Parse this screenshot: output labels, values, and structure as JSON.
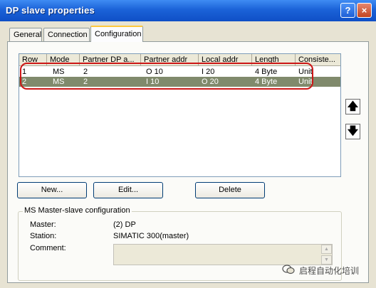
{
  "window": {
    "title": "DP slave properties"
  },
  "tabs": [
    "General",
    "Connection",
    "Configuration"
  ],
  "table": {
    "columns": [
      "Row",
      "Mode",
      "Partner DP a...",
      "Partner addr",
      "Local addr",
      "Length",
      "Consiste..."
    ],
    "rows": [
      [
        "1",
        "MS",
        "2",
        "O 10",
        "I 20",
        "4 Byte",
        "Unit"
      ],
      [
        "2",
        "MS",
        "2",
        "I 10",
        "O 20",
        "4 Byte",
        "Unit"
      ]
    ]
  },
  "buttons": {
    "new": "New...",
    "edit": "Edit...",
    "delete": "Delete"
  },
  "arrows": {
    "up": "🡅",
    "down": "🡇"
  },
  "group": {
    "title": "MS Master-slave configuration",
    "master_label": "Master:",
    "master_value": "(2) DP",
    "station_label": "Station:",
    "station_value": "SIMATIC 300(master)",
    "comment_label": "Comment:"
  },
  "watermark": "启程自动化培训"
}
